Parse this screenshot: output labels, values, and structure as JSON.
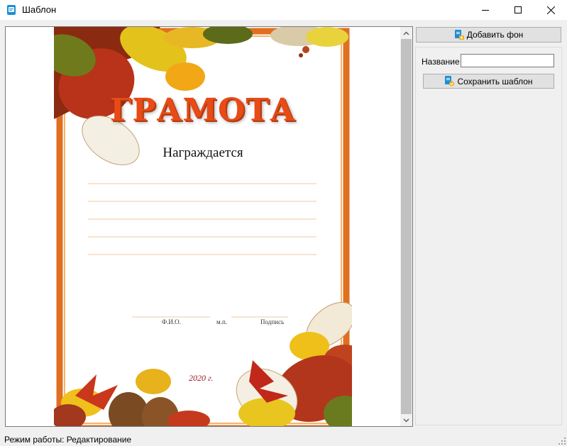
{
  "window": {
    "title": "Шаблон",
    "controls": [
      "minimize",
      "maximize",
      "close"
    ]
  },
  "certificate": {
    "title": "ГРАМОТА",
    "subtitle": "Награждается",
    "signature_labels": [
      "Ф.И.О.",
      "м.п.",
      "Подпись"
    ],
    "year": "2020 г."
  },
  "right_panel": {
    "add_background_label": "Добавить фон",
    "name_label": "Название",
    "name_value": "",
    "save_template_label": "Сохранить шаблон"
  },
  "status": {
    "text": "Режим работы: Редактирование"
  },
  "colors": {
    "frame_orange": "#e07020",
    "title_orange": "#e84b16",
    "year_red": "#a0161e"
  }
}
